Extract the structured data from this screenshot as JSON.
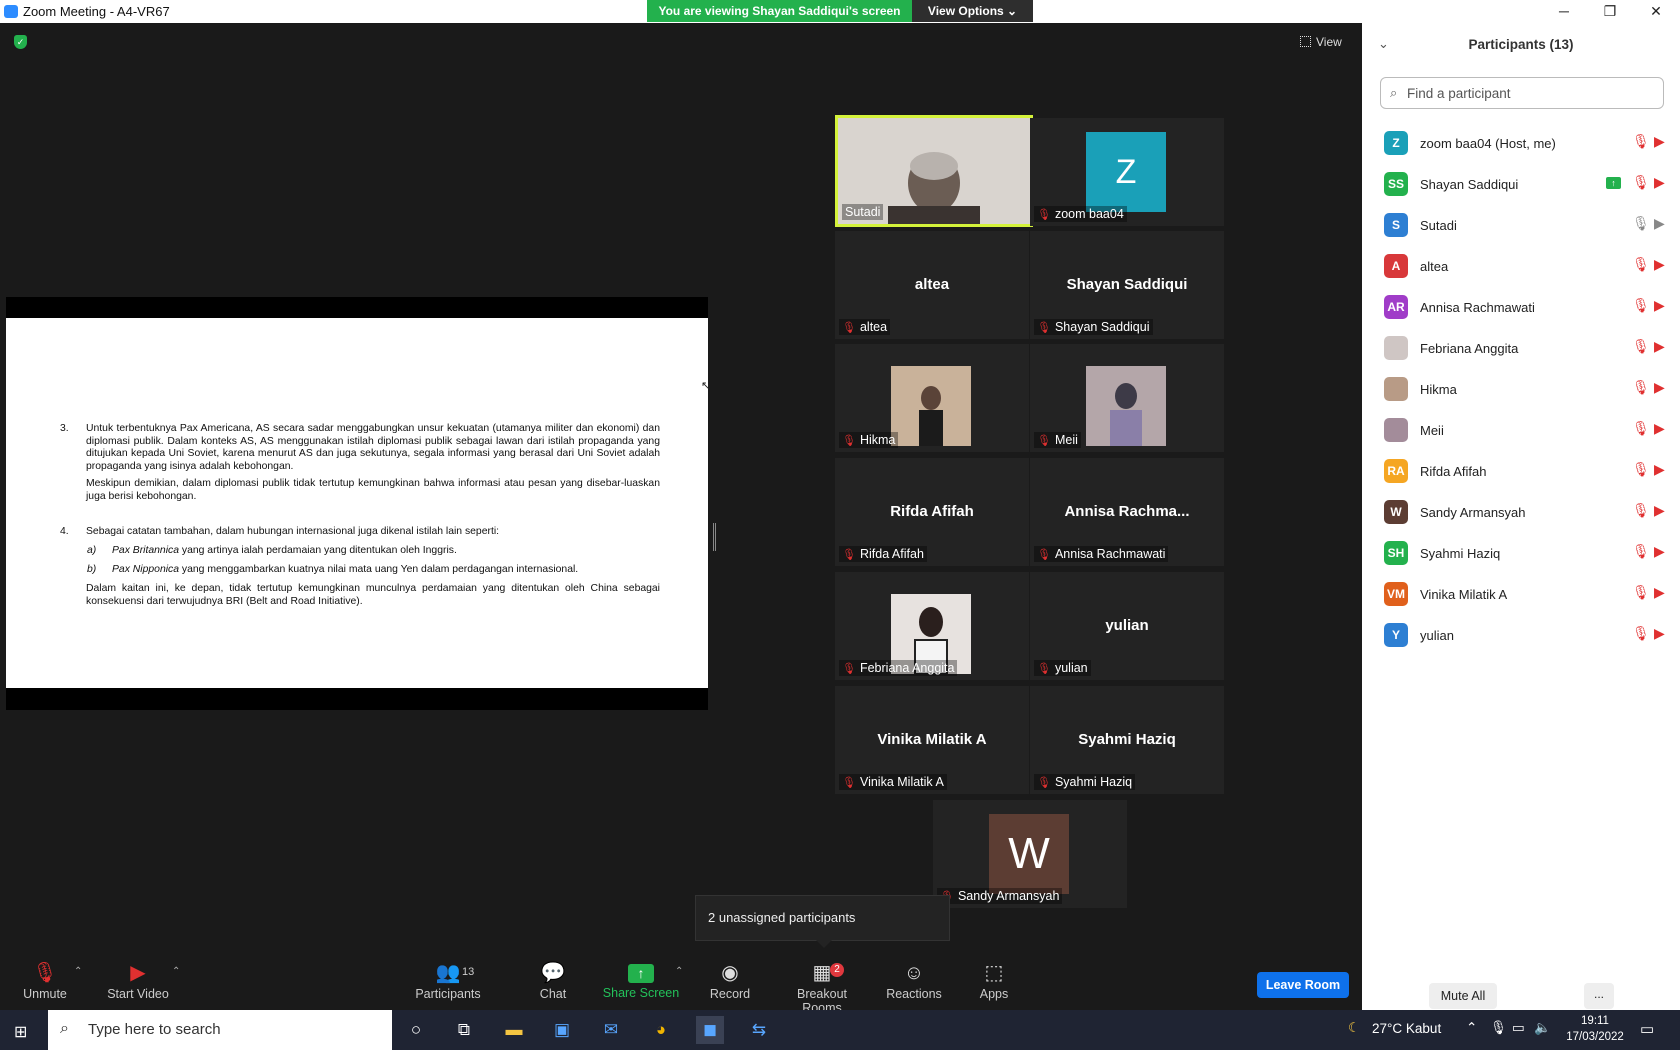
{
  "window": {
    "title": "Zoom Meeting - A4-VR67",
    "minimize": "─",
    "maximize": "❐",
    "close": "✕"
  },
  "banner": {
    "text": "You are viewing Shayan Saddiqui's screen",
    "view_options": "View Options ⌄"
  },
  "view_button": "View",
  "document": {
    "p3_num": "3.",
    "p3_text": "Untuk terbentuknya Pax Americana, AS secara sadar menggabungkan unsur kekuatan (utamanya militer dan ekonomi) dan diplomasi publik. Dalam konteks AS, AS menggunakan istilah diplomasi publik sebagai lawan dari istilah propaganda yang ditujukan kepada Uni Soviet, karena menurut AS dan juga sekutunya, segala informasi yang berasal dari Uni Soviet adalah propaganda yang isinya adalah kebohongan.",
    "p3b_text": "Meskipun demikian, dalam diplomasi publik tidak tertutup kemungkinan bahwa informasi atau pesan yang disebar-luaskan juga berisi kebohongan.",
    "p4_num": "4.",
    "p4_text": "Sebagai catatan tambahan, dalam hubungan internasional juga dikenal istilah lain seperti:",
    "a_label": "a)",
    "a_term": "Pax Britannica",
    "a_text": " yang artinya ialah perdamaian yang ditentukan oleh Inggris.",
    "b_label": "b)",
    "b_term": "Pax Nipponica",
    "b_text": " yang menggambarkan kuatnya nilai mata uang Yen dalam perdagangan internasional.",
    "p4b_text": "Dalam kaitan ini, ke depan, tidak tertutup kemungkinan munculnya perdamaian yang ditentukan oleh China sebagai konsekuensi dari terwujudnya BRI (Belt and Road Initiative)."
  },
  "tiles": {
    "sutadi": {
      "label": "Sutadi"
    },
    "zoom": {
      "avatar": "Z",
      "label": "zoom baa04"
    },
    "altea": {
      "name": "altea",
      "label": "altea"
    },
    "shayan": {
      "name": "Shayan Saddiqui",
      "label": "Shayan Saddiqui"
    },
    "hikma": {
      "label": "Hikma"
    },
    "meii": {
      "label": "Meii"
    },
    "rifda": {
      "name": "Rifda Afifah",
      "label": "Rifda Afifah"
    },
    "annisa": {
      "name": "Annisa  Rachma...",
      "label": "Annisa Rachmawati"
    },
    "febriana": {
      "label": "Febriana Anggita"
    },
    "yulian": {
      "name": "yulian",
      "label": "yulian"
    },
    "vinika": {
      "name": "Vinika Milatik A",
      "label": "Vinika Milatik A"
    },
    "syahmi": {
      "name": "Syahmi Haziq",
      "label": "Syahmi Haziq"
    },
    "sandy": {
      "avatar": "W",
      "label": "Sandy Armansyah"
    }
  },
  "tooltip": "2 unassigned participants",
  "toolbar": {
    "unmute": "Unmute",
    "start_video": "Start Video",
    "participants": "Participants",
    "participants_count": "13",
    "chat": "Chat",
    "share_screen": "Share Screen",
    "record": "Record",
    "breakout": "Breakout Rooms",
    "breakout_badge": "2",
    "reactions": "Reactions",
    "apps": "Apps",
    "leave": "Leave Room"
  },
  "panel": {
    "title": "Participants (13)",
    "search_placeholder": "Find a participant",
    "participants": [
      {
        "initials": "Z",
        "name": "zoom baa04 (Host, me)",
        "color": "#1aa0b8"
      },
      {
        "initials": "SS",
        "name": "Shayan Saddiqui",
        "color": "#23b14d"
      },
      {
        "initials": "S",
        "name": "Sutadi",
        "color": "#2d7fd3"
      },
      {
        "initials": "A",
        "name": "altea",
        "color": "#d8383a"
      },
      {
        "initials": "AR",
        "name": "Annisa Rachmawati",
        "color": "#a03cc8"
      },
      {
        "initials": "",
        "name": "Febriana Anggita",
        "color": "#cfc6c4"
      },
      {
        "initials": "",
        "name": "Hikma",
        "color": "#b89b86"
      },
      {
        "initials": "",
        "name": "Meii",
        "color": "#a38c9a"
      },
      {
        "initials": "RA",
        "name": "Rifda Afifah",
        "color": "#f5a623"
      },
      {
        "initials": "W",
        "name": "Sandy Armansyah",
        "color": "#5c3d33"
      },
      {
        "initials": "SH",
        "name": "Syahmi Haziq",
        "color": "#23b14d"
      },
      {
        "initials": "VM",
        "name": "Vinika Milatik A",
        "color": "#e0601c"
      },
      {
        "initials": "Y",
        "name": "yulian",
        "color": "#2d7fd3"
      }
    ],
    "mute_all": "Mute All",
    "more": "..."
  },
  "taskbar": {
    "search_placeholder": "Type here to search",
    "weather": "27°C  Kabut",
    "time": "19:11",
    "date": "17/03/2022"
  }
}
